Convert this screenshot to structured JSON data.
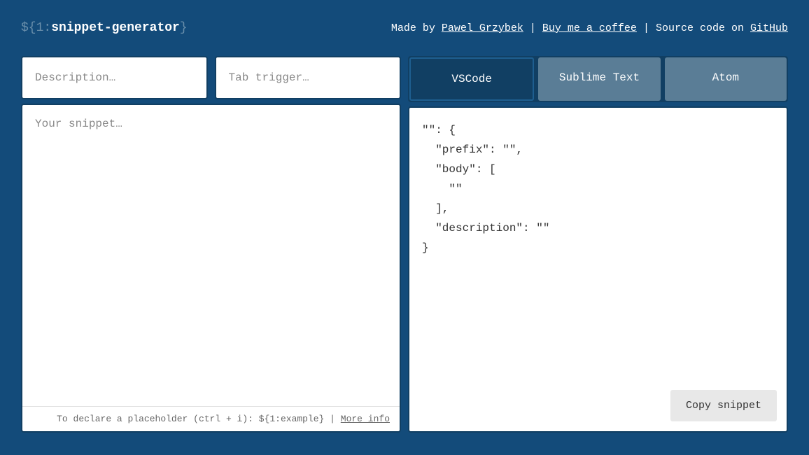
{
  "header": {
    "logo_prefix": "${1:",
    "logo_main": "snippet-generator",
    "logo_suffix": "}",
    "made_by_text": "Made by ",
    "author_link": "Pawel Grzybek",
    "sep1": " | ",
    "coffee_link": "Buy me a coffee",
    "sep2": " | ",
    "source_text": "Source code on ",
    "github_link": "GitHub"
  },
  "inputs": {
    "description_placeholder": "Description…",
    "description_value": "",
    "trigger_placeholder": "Tab trigger…",
    "trigger_value": "",
    "snippet_placeholder": "Your snippet…",
    "snippet_value": ""
  },
  "tabs": {
    "vscode": "VSCode",
    "sublime": "Sublime Text",
    "atom": "Atom",
    "active": "vscode"
  },
  "output": {
    "code": "\"\": {\n  \"prefix\": \"\",\n  \"body\": [\n    \"\"\n  ],\n  \"description\": \"\"\n}"
  },
  "hint": {
    "text": "To declare a placeholder (ctrl + i): ${1:example} | ",
    "more_info": "More info"
  },
  "copy_button": "Copy snippet"
}
